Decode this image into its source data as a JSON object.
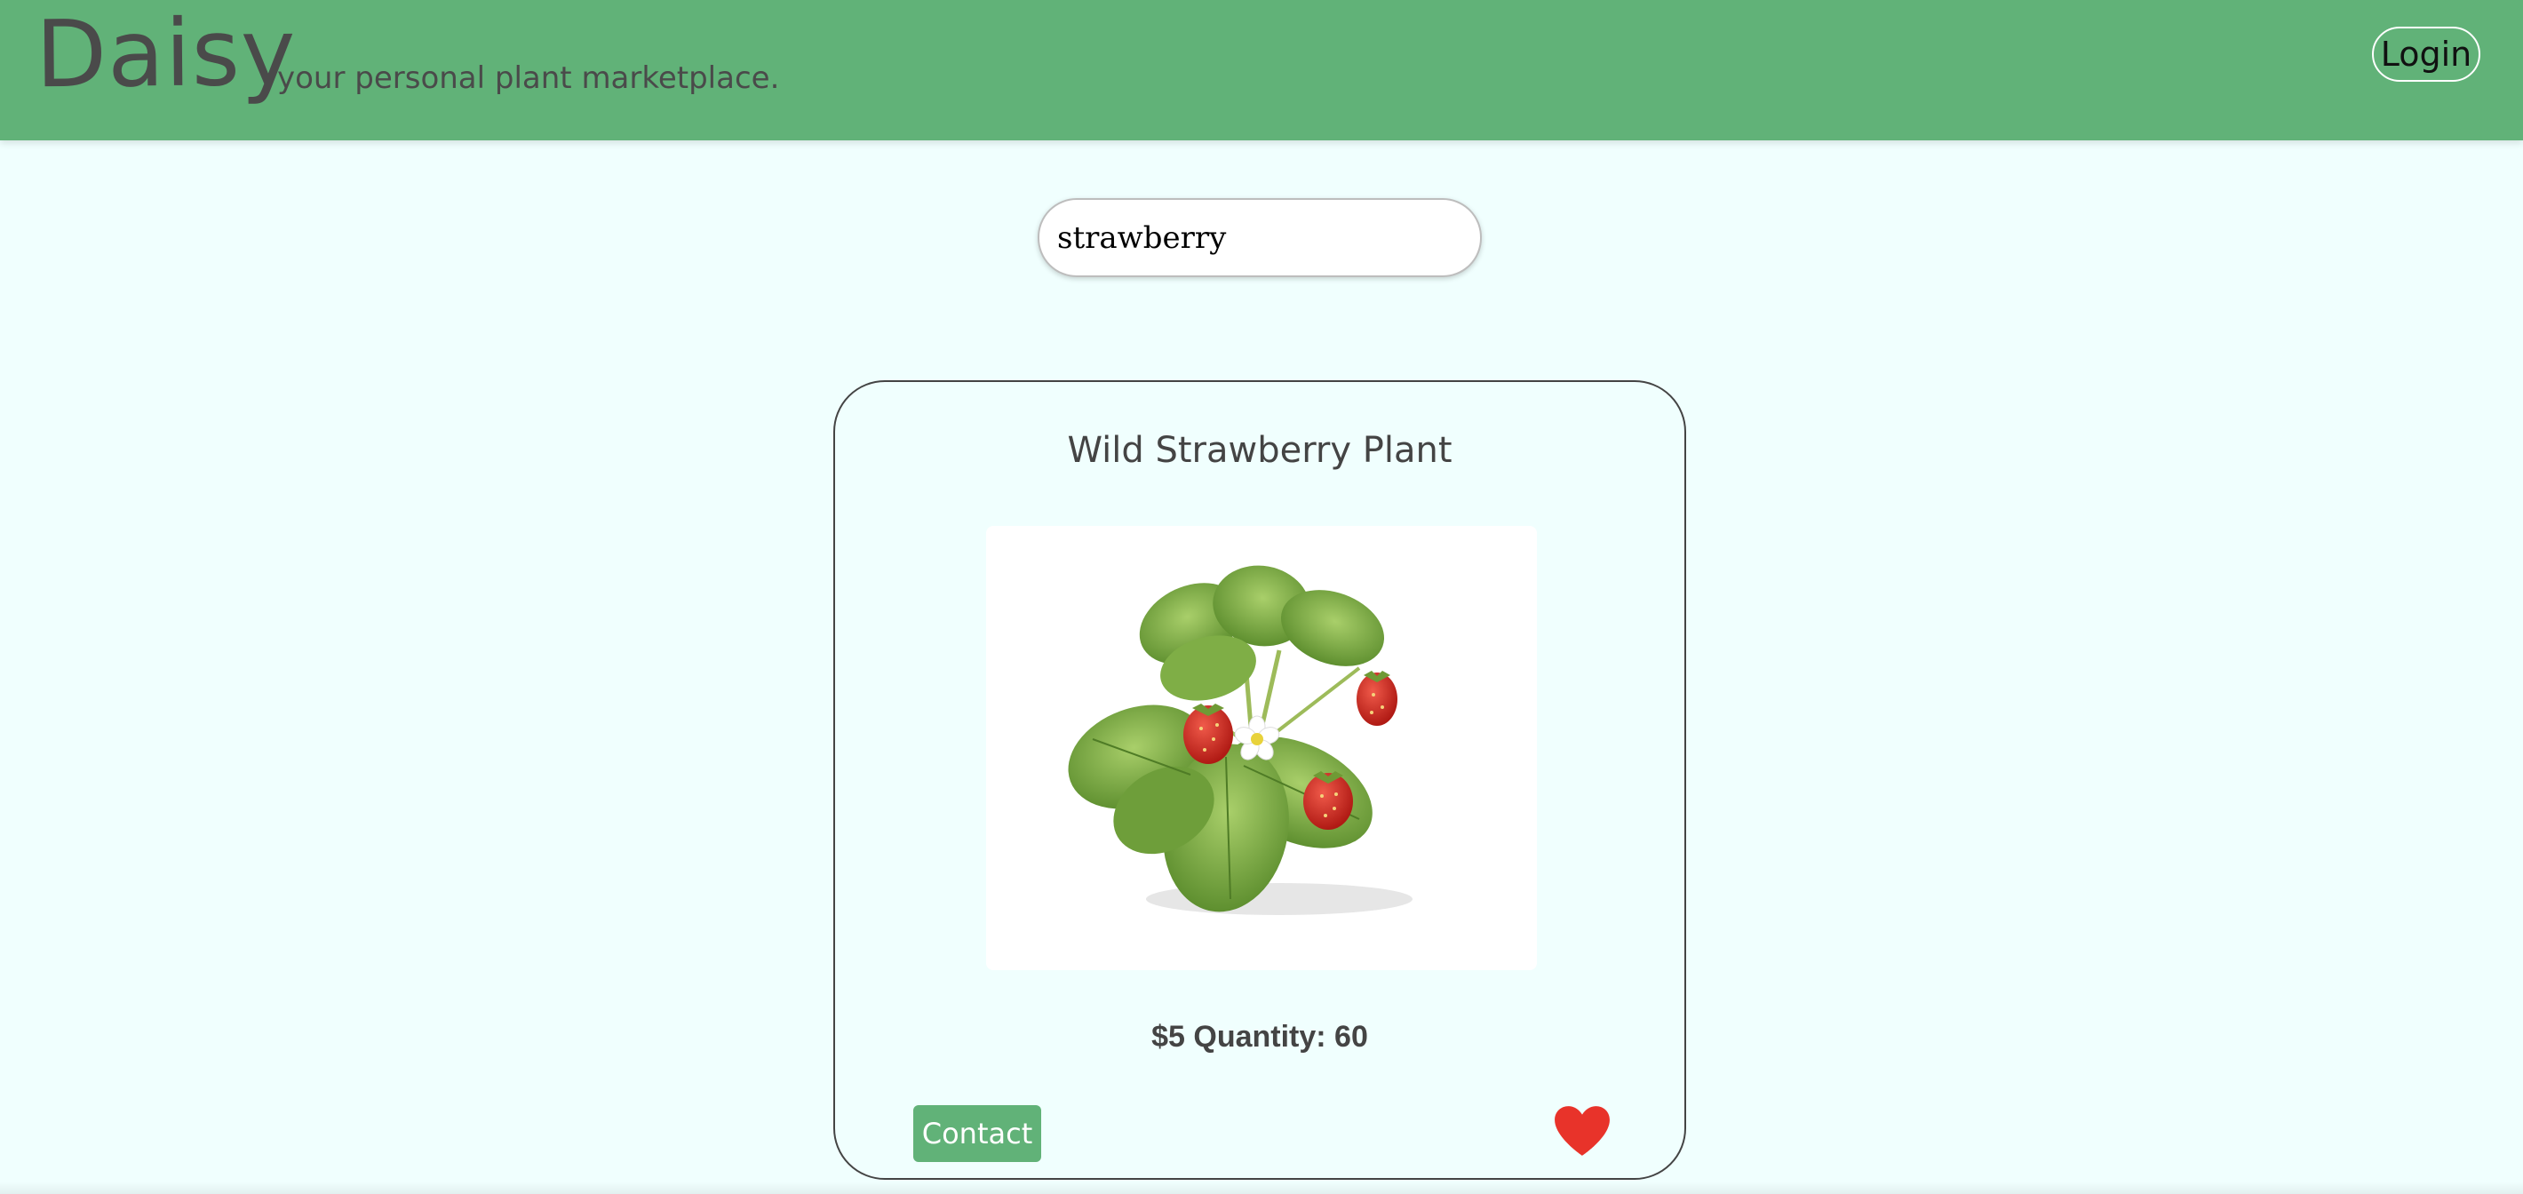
{
  "header": {
    "brand": "Daisy",
    "tagline": "your personal plant marketplace.",
    "login_label": "Login"
  },
  "search": {
    "value": "strawberry"
  },
  "listing": {
    "title": "Wild Strawberry Plant",
    "price_quantity": "$5 Quantity: 60",
    "contact_label": "Contact",
    "favorite_icon": "heart-icon",
    "image_subject": "strawberry plant with leaves, flower and red berries"
  },
  "colors": {
    "header_bg": "#61b278",
    "page_bg": "#f0fffe",
    "text": "#444444",
    "accent_button": "#61b278",
    "heart": "#e8332a"
  }
}
